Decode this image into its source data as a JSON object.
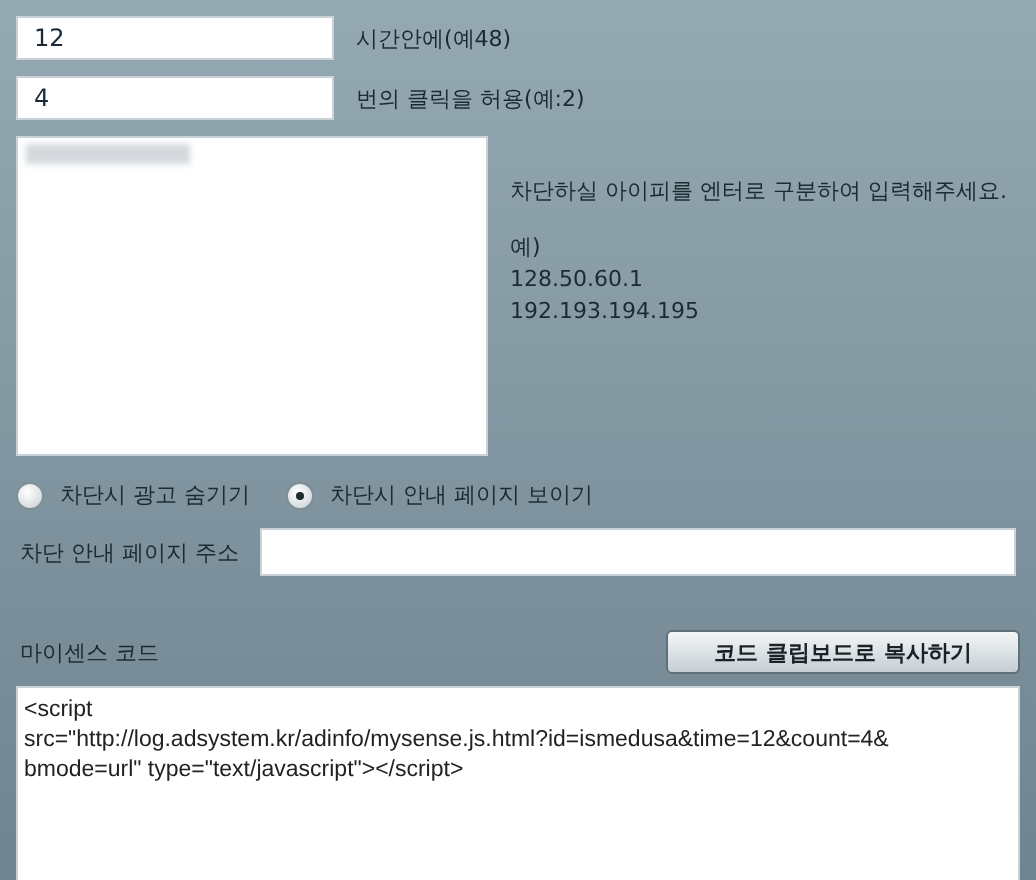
{
  "fields": [
    {
      "value": "12",
      "label": "시간안에(예48)"
    },
    {
      "value": "4",
      "label": "번의 클릭을 허용(예:2)"
    }
  ],
  "ip_box": {
    "redacted": true
  },
  "ip_help": {
    "instruction": "차단하실 아이피를 엔터로 구분하여 입력해주세요.",
    "example_title": "예)",
    "examples": [
      "128.50.60.1",
      "192.193.194.195"
    ]
  },
  "radios": [
    {
      "label": "차단시 광고 숨기기",
      "selected": false
    },
    {
      "label": "차단시 안내 페이지 보이기",
      "selected": true
    }
  ],
  "page_url": {
    "label": "차단 안내 페이지 주소"
  },
  "code": {
    "label": "마이센스 코드",
    "button": "코드 클립보드로 복사하기",
    "lines": [
      "<script",
      "src=\"http://log.adsystem.kr/adinfo/mysense.js.html?id=ismedusa&time=12&count=4&",
      "bmode=url\" type=\"text/javascript\"></script>"
    ]
  }
}
